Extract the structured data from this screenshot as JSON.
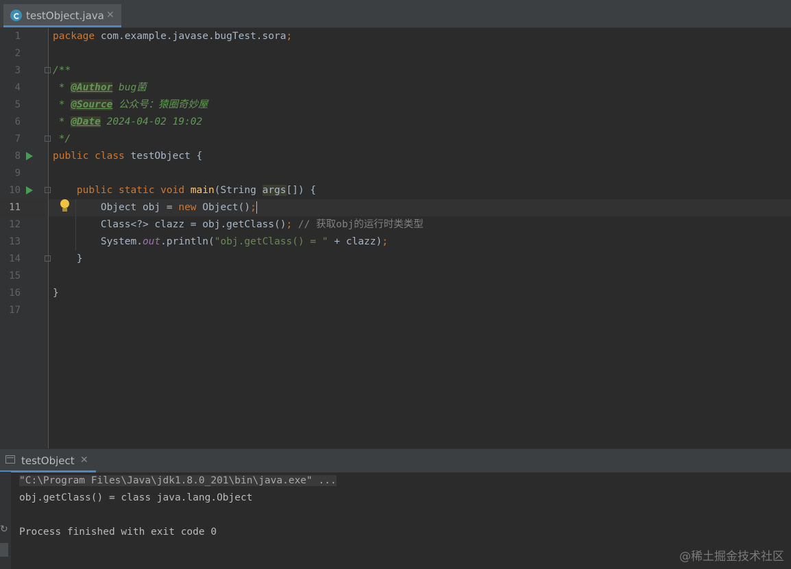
{
  "editor_tab": {
    "label": "testObject.java",
    "close": "✕",
    "icon": "java-class-icon"
  },
  "line_numbers": [
    "1",
    "2",
    "3",
    "4",
    "5",
    "6",
    "7",
    "8",
    "9",
    "10",
    "11",
    "12",
    "13",
    "14",
    "15",
    "16",
    "17"
  ],
  "code": {
    "l1": {
      "kw": "package",
      "rest": " com.example.javase.bugTest.sora",
      "semi": ";"
    },
    "l3": "/**",
    "l4": {
      "star": " * ",
      "tag": "@Author",
      "text": " bug菌"
    },
    "l5": {
      "star": " * ",
      "tag": "@Source",
      "text": " 公众号：猿圈奇妙屋"
    },
    "l6": {
      "star": " * ",
      "tag": "@Date",
      "text": " 2024-04-02 19:02"
    },
    "l7": " */",
    "l8": {
      "kw1": "public",
      "kw2": "class",
      "name": " testObject {"
    },
    "l10": {
      "indent": "    ",
      "kw1": "public",
      "kw2": "static",
      "kw3": "void",
      "fn": "main",
      "p1": "(String ",
      "param": "args",
      "p2": "[]) {"
    },
    "l11": {
      "indent": "        ",
      "t1": "Object obj = ",
      "kw": "new",
      "t2": " Object()",
      "semi": ";"
    },
    "l12": {
      "indent": "        ",
      "t1": "Class<?> clazz = obj.getClass()",
      "semi": ";",
      "comment": " // 获取obj的运行时类类型"
    },
    "l13": {
      "indent": "        ",
      "t1": "System.",
      "field": "out",
      "t2": ".println(",
      "str": "\"obj.getClass() = \"",
      "t3": " + clazz)",
      "semi": ";"
    },
    "l14": "    }",
    "l16": "}"
  },
  "run_tab": {
    "label": "testObject",
    "close": "✕"
  },
  "console": {
    "command": "\"C:\\Program Files\\Java\\jdk1.8.0_201\\bin\\java.exe\" ...",
    "output": "obj.getClass() = class java.lang.Object",
    "exit": "Process finished with exit code 0"
  },
  "watermark": "@稀土掘金技术社区"
}
